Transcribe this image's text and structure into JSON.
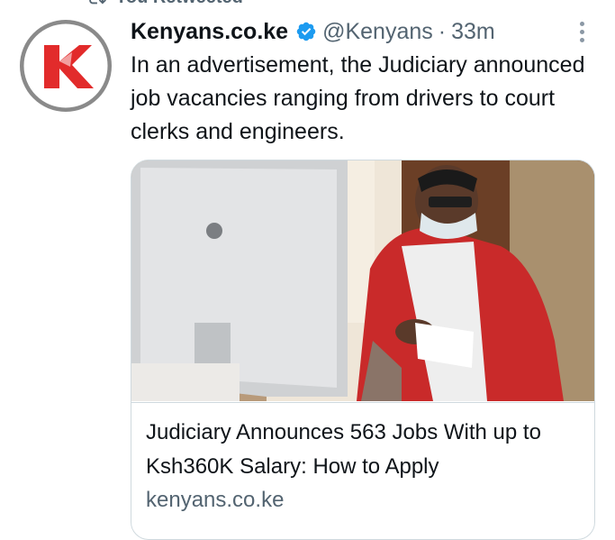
{
  "retweet": {
    "label": "You Retweeted",
    "icon": "retweet-icon"
  },
  "tweet": {
    "author_name": "Kenyans.co.ke",
    "verified_icon": "verified-badge-icon",
    "handle": "@Kenyans",
    "separator": "·",
    "time": "33m",
    "text": "In an advertisement, the Judiciary announced job vacancies ranging from drivers to court clerks and engineers.",
    "more_icon": "more-options-icon"
  },
  "card": {
    "title": "Judiciary Announces 563 Jobs With up to Ksh360K Salary: How to Apply",
    "domain": "kenyans.co.ke"
  },
  "colors": {
    "text": "#0f1419",
    "secondary": "#536471",
    "verified": "#1d9bf0",
    "logo_red": "#e22b2b",
    "border": "#cfd9de"
  }
}
